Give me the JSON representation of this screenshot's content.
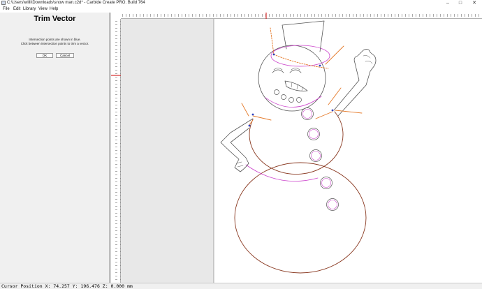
{
  "window": {
    "title": "C:\\Users\\willi\\Downloads\\snow man.c2d* - Carbide Create PRO. Build 764",
    "minimize_glyph": "–",
    "maximize_glyph": "□",
    "close_glyph": "✕"
  },
  "menu": {
    "items": [
      "File",
      "Edit",
      "Library",
      "View",
      "Help"
    ]
  },
  "panel": {
    "title": "Trim Vector",
    "line1": "Intersection points are shown in blue.",
    "line2": "Click between intersection points to trim a vector.",
    "ok_label": "OK",
    "cancel_label": "Cancel"
  },
  "status": {
    "cursor_position": "Cursor Position X: 74.257 Y: 196.476 Z: 0.000 mm"
  },
  "colors": {
    "vector_outline": "#555555",
    "selected_vector": "#cc44cc",
    "trim_preview": "#e57a2a",
    "outer_body": "#8a3a22",
    "intersection_point": "#2a3fbf",
    "ruler_marker": "#cc0000"
  },
  "icons": {
    "app": "carbide-create-icon"
  }
}
